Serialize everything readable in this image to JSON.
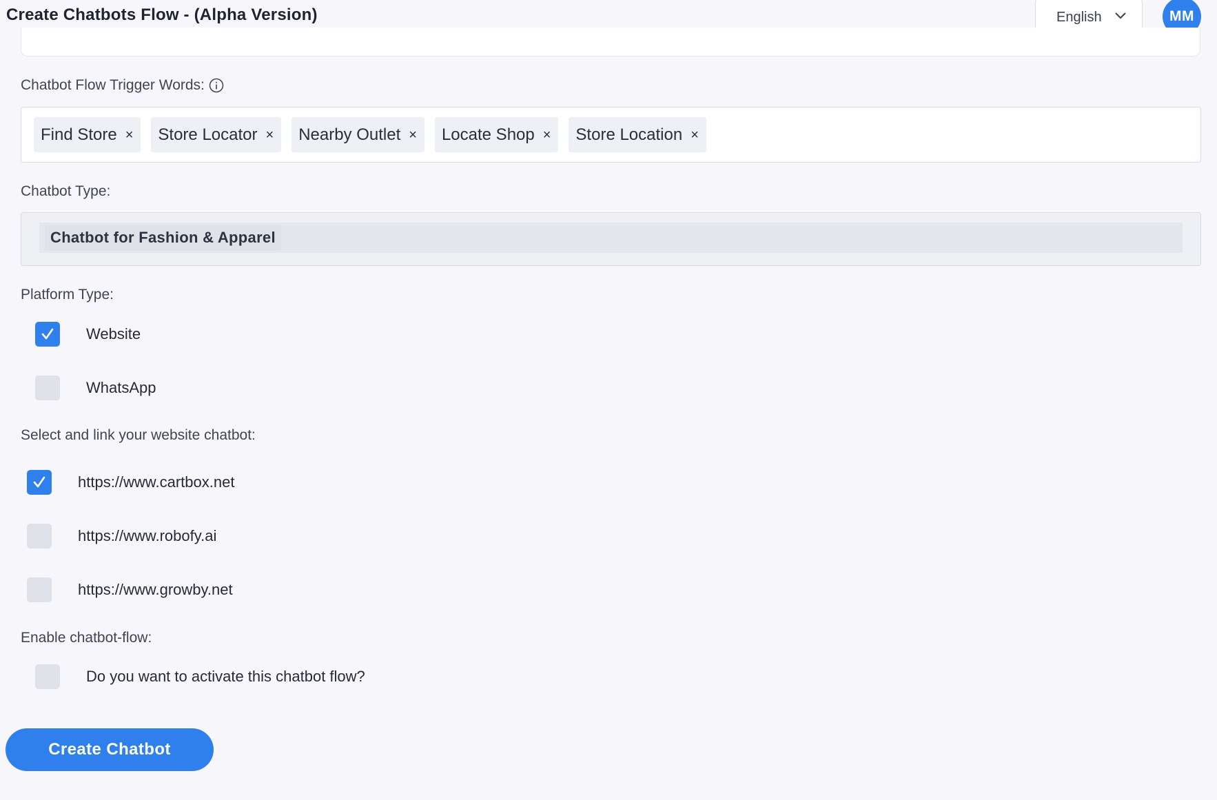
{
  "header": {
    "title": "Create Chatbots Flow - (Alpha Version)",
    "language": "English",
    "avatar_initials": "MM"
  },
  "trigger_words": {
    "label": "Chatbot Flow Trigger Words:",
    "tags": [
      "Find Store",
      "Store Locator",
      "Nearby Outlet",
      "Locate Shop",
      "Store Location"
    ],
    "remove_glyph": "×"
  },
  "chatbot_type": {
    "label": "Chatbot Type:",
    "value": "Chatbot for Fashion & Apparel"
  },
  "platform_type": {
    "label": "Platform Type:",
    "options": [
      {
        "label": "Website",
        "checked": true
      },
      {
        "label": "WhatsApp",
        "checked": false
      }
    ]
  },
  "website_link": {
    "label": "Select and link your website chatbot:",
    "options": [
      {
        "label": "https://www.cartbox.net",
        "checked": true
      },
      {
        "label": "https://www.robofy.ai",
        "checked": false
      },
      {
        "label": "https://www.growby.net",
        "checked": false
      }
    ]
  },
  "enable_flow": {
    "label": "Enable chatbot-flow:",
    "option": {
      "label": "Do you want to activate this chatbot flow?",
      "checked": false
    }
  },
  "actions": {
    "create_label": "Create Chatbot"
  },
  "colors": {
    "accent": "#2f80ed",
    "background": "#f7f7fb",
    "unchecked": "#dfe1e9"
  }
}
